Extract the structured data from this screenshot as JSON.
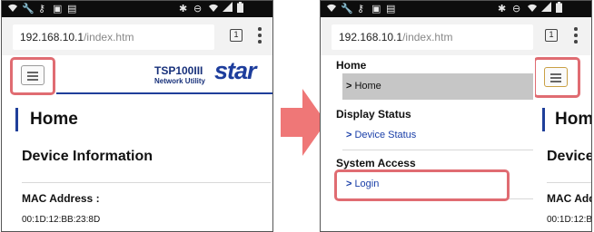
{
  "browser": {
    "url_host": "192.168.10.1",
    "url_path": "/index.htm",
    "tab_count": "1"
  },
  "icons": [
    "wifi-icon",
    "wrench-icon",
    "key-icon",
    "image-icon",
    "memo-icon",
    "bluetooth-icon",
    "do-not-disturb-icon",
    "signal-icon",
    "battery-icon",
    "hamburger-menu-icon",
    "overflow-menu-icon",
    "chevron-right-icon",
    "right-arrow-icon"
  ],
  "colors": {
    "highlight": "#e06c72",
    "brand_blue": "#1f3f9a",
    "link_blue": "#1a3fa8",
    "arrow": "#ef7777",
    "selected_menu_bg": "#c6c6c6"
  },
  "header": {
    "logo_model": "TSP100III",
    "logo_subtitle": "Network Utility",
    "logo_brand": "star"
  },
  "left_page": {
    "title": "Home",
    "section_title": "Device Information",
    "mac_label": "MAC Address :",
    "mac_value": "00:1D:12:BB:23:8D"
  },
  "menu": {
    "groups": [
      {
        "heading": "Home",
        "items": [
          {
            "label": "Home",
            "selected": true
          }
        ]
      },
      {
        "heading": "Display Status",
        "items": [
          {
            "label": "Device Status",
            "selected": false
          }
        ]
      },
      {
        "heading": "System Access",
        "items": [
          {
            "label": "Login",
            "selected": false
          }
        ]
      }
    ]
  },
  "right_page_partial": {
    "title": "Hom",
    "section_title": "Device",
    "mac_label": "MAC Addr",
    "mac_value": "00:1D:12:B"
  }
}
